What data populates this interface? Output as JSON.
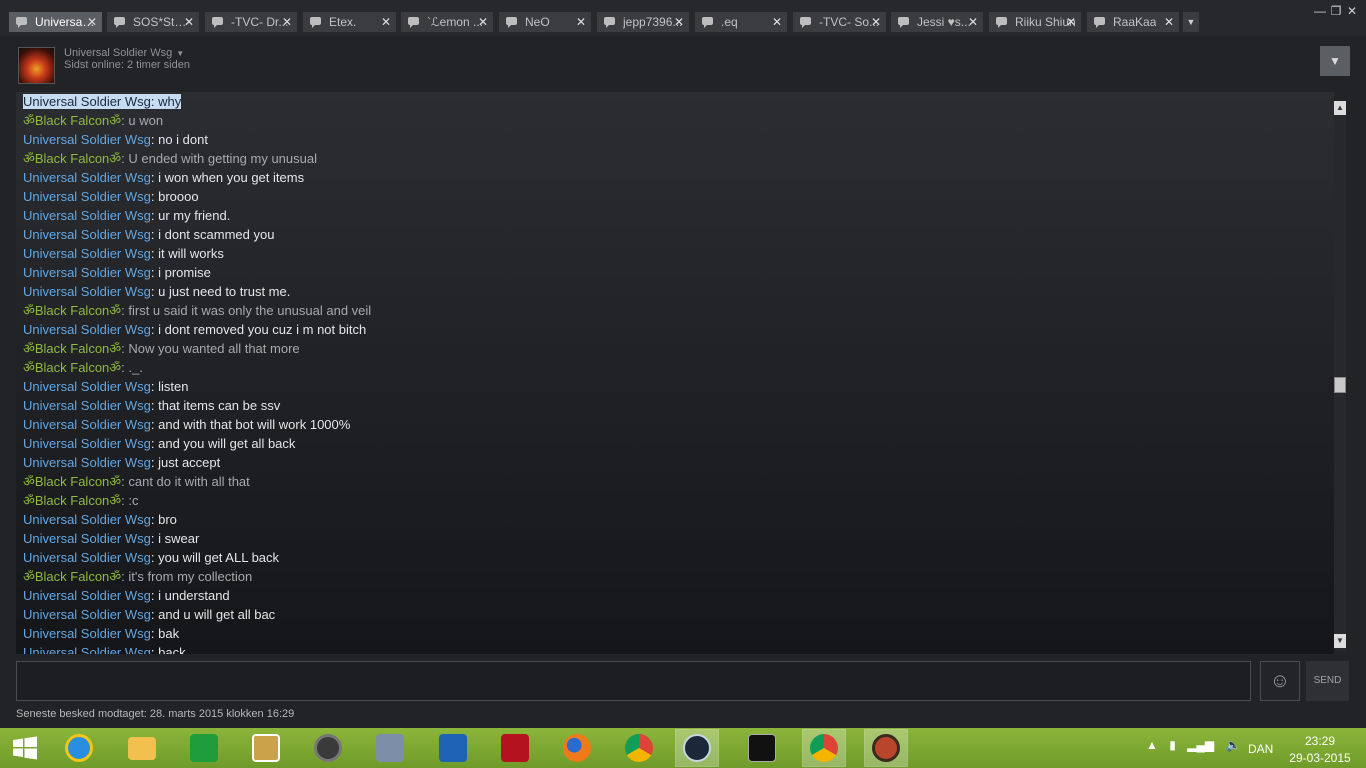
{
  "tabs": [
    {
      "label": "Universal..."
    },
    {
      "label": "SOS*Stei..."
    },
    {
      "label": "-TVC- Dr..."
    },
    {
      "label": "Etex."
    },
    {
      "label": "`ℒemon ..."
    },
    {
      "label": "NeO"
    },
    {
      "label": "jepp7396..."
    },
    {
      "label": ".eq"
    },
    {
      "label": "-TVC- So..."
    },
    {
      "label": "Jessi ♥s..."
    },
    {
      "label": "Riiku Shiun"
    },
    {
      "label": "RaaKaa"
    }
  ],
  "header": {
    "friend_name": "Universal Soldier Wsg",
    "status": "Sidst online: 2 timer siden"
  },
  "chat": {
    "messages": [
      {
        "sender": "Universal Soldier Wsg",
        "text": "why"
      },
      {
        "sender": "ॐBlack Falconॐ",
        "text": "u won"
      },
      {
        "sender": "Universal Soldier Wsg",
        "text": "no i dont"
      },
      {
        "sender": "ॐBlack Falconॐ",
        "text": "U ended with getting my unusual"
      },
      {
        "sender": "Universal Soldier Wsg",
        "text": "i won when you get items"
      },
      {
        "sender": "Universal Soldier Wsg",
        "text": "broooo"
      },
      {
        "sender": "Universal Soldier Wsg",
        "text": "ur my friend."
      },
      {
        "sender": "Universal Soldier Wsg",
        "text": "i dont scammed you"
      },
      {
        "sender": "Universal Soldier Wsg",
        "text": "it will works"
      },
      {
        "sender": "Universal Soldier Wsg",
        "text": "i promise"
      },
      {
        "sender": "Universal Soldier Wsg",
        "text": "u just need to trust me."
      },
      {
        "sender": "ॐBlack Falconॐ",
        "text": "first u said it was only the unusual and veil"
      },
      {
        "sender": "Universal Soldier Wsg",
        "text": "i dont removed you cuz i m not bitch"
      },
      {
        "sender": "ॐBlack Falconॐ",
        "text": "Now you wanted all that more"
      },
      {
        "sender": "ॐBlack Falconॐ",
        "text": "._."
      },
      {
        "sender": "Universal Soldier Wsg",
        "text": "listen"
      },
      {
        "sender": "Universal Soldier Wsg",
        "text": "that items can be ssv"
      },
      {
        "sender": "Universal Soldier Wsg",
        "text": "and with that bot will work 1000%"
      },
      {
        "sender": "Universal Soldier Wsg",
        "text": "and you will get all back"
      },
      {
        "sender": "Universal Soldier Wsg",
        "text": "just accept"
      },
      {
        "sender": "ॐBlack Falconॐ",
        "text": "cant do it with all that"
      },
      {
        "sender": "ॐBlack Falconॐ",
        "text": ":c"
      },
      {
        "sender": "Universal Soldier Wsg",
        "text": "bro"
      },
      {
        "sender": "Universal Soldier Wsg",
        "text": "i swear"
      },
      {
        "sender": "Universal Soldier Wsg",
        "text": "you will get ALL back"
      },
      {
        "sender": "ॐBlack Falconॐ",
        "text": "it's from my collection"
      },
      {
        "sender": "Universal Soldier Wsg",
        "text": "i understand"
      },
      {
        "sender": "Universal Soldier Wsg",
        "text": "and u will get all bac"
      },
      {
        "sender": "Universal Soldier Wsg",
        "text": "bak"
      },
      {
        "sender": "Universal Soldier Wsg",
        "text": "back"
      }
    ]
  },
  "input": {
    "value": "",
    "send_label": "SEND"
  },
  "footer": {
    "last_message": "Seneste besked modtaget: 28. marts 2015 klokken 16:29"
  },
  "taskbar": {
    "apps": [
      "windows-start",
      "internet-explorer",
      "file-explorer",
      "store",
      "media-player",
      "speaker",
      "docs",
      "settings",
      "power",
      "firefox",
      "chrome",
      "steam",
      "command-prompt",
      "chrome",
      "team-fortress-2"
    ],
    "language": "DAN",
    "time": "23:29",
    "date": "29-03-2015"
  },
  "colors": {
    "sender_universal": "#62a7e3",
    "sender_falcon": "#8fba3c",
    "taskbar": "#7aa832",
    "background": "#212326"
  }
}
